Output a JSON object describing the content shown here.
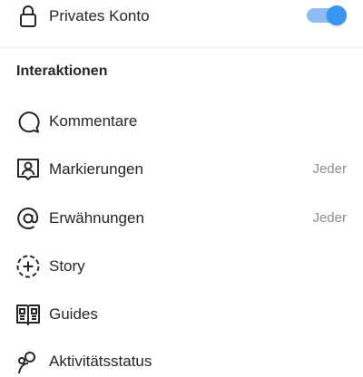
{
  "privacy": {
    "private_account_label": "Privates Konto",
    "private_account_enabled": true
  },
  "interactions": {
    "title": "Interaktionen",
    "items": [
      {
        "label": "Kommentare",
        "icon": "comment-icon",
        "value": ""
      },
      {
        "label": "Markierungen",
        "icon": "tag-person-icon",
        "value": "Jeder"
      },
      {
        "label": "Erwähnungen",
        "icon": "mention-icon",
        "value": "Jeder"
      },
      {
        "label": "Story",
        "icon": "story-add-icon",
        "value": ""
      },
      {
        "label": "Guides",
        "icon": "guides-book-icon",
        "value": ""
      },
      {
        "label": "Aktivitätsstatus",
        "icon": "activity-status-icon",
        "value": ""
      }
    ]
  },
  "colors": {
    "toggle_on": "#3797f0",
    "secondary_text": "#8e8e8e"
  }
}
